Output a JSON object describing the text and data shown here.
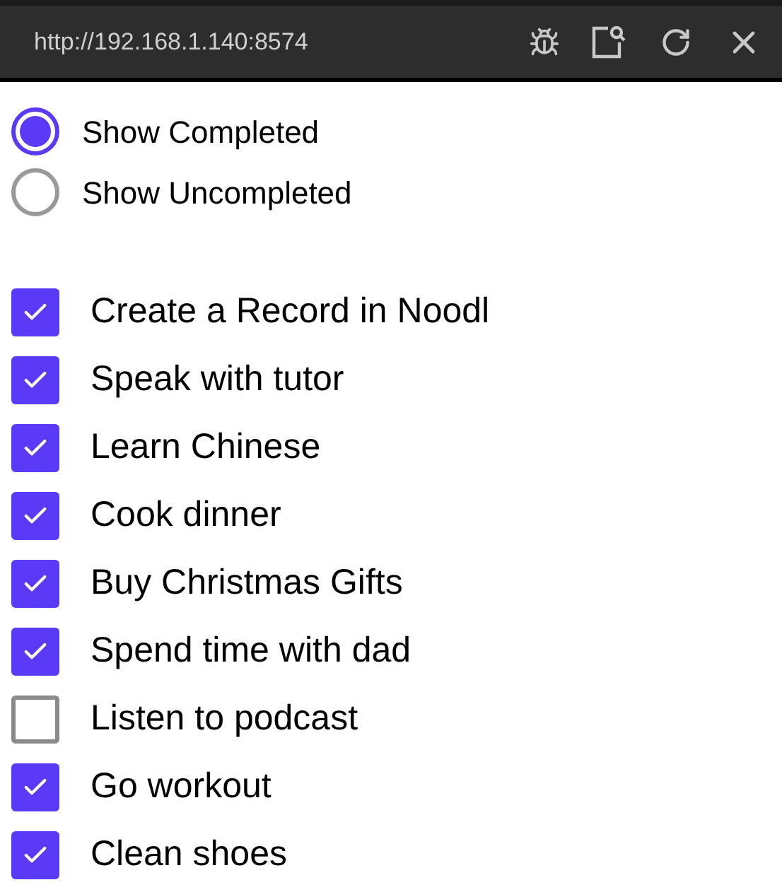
{
  "address_bar": {
    "url": "http://192.168.1.140:8574"
  },
  "filters": [
    {
      "label": "Show Completed",
      "selected": true
    },
    {
      "label": "Show Uncompleted",
      "selected": false
    }
  ],
  "tasks": [
    {
      "label": "Create a Record in Noodl",
      "checked": true
    },
    {
      "label": "Speak with tutor",
      "checked": true
    },
    {
      "label": "Learn Chinese",
      "checked": true
    },
    {
      "label": "Cook dinner",
      "checked": true
    },
    {
      "label": "Buy Christmas Gifts",
      "checked": true
    },
    {
      "label": "Spend time with dad",
      "checked": true
    },
    {
      "label": "Listen to podcast",
      "checked": false
    },
    {
      "label": "Go workout",
      "checked": true
    },
    {
      "label": "Clean shoes",
      "checked": true
    }
  ]
}
